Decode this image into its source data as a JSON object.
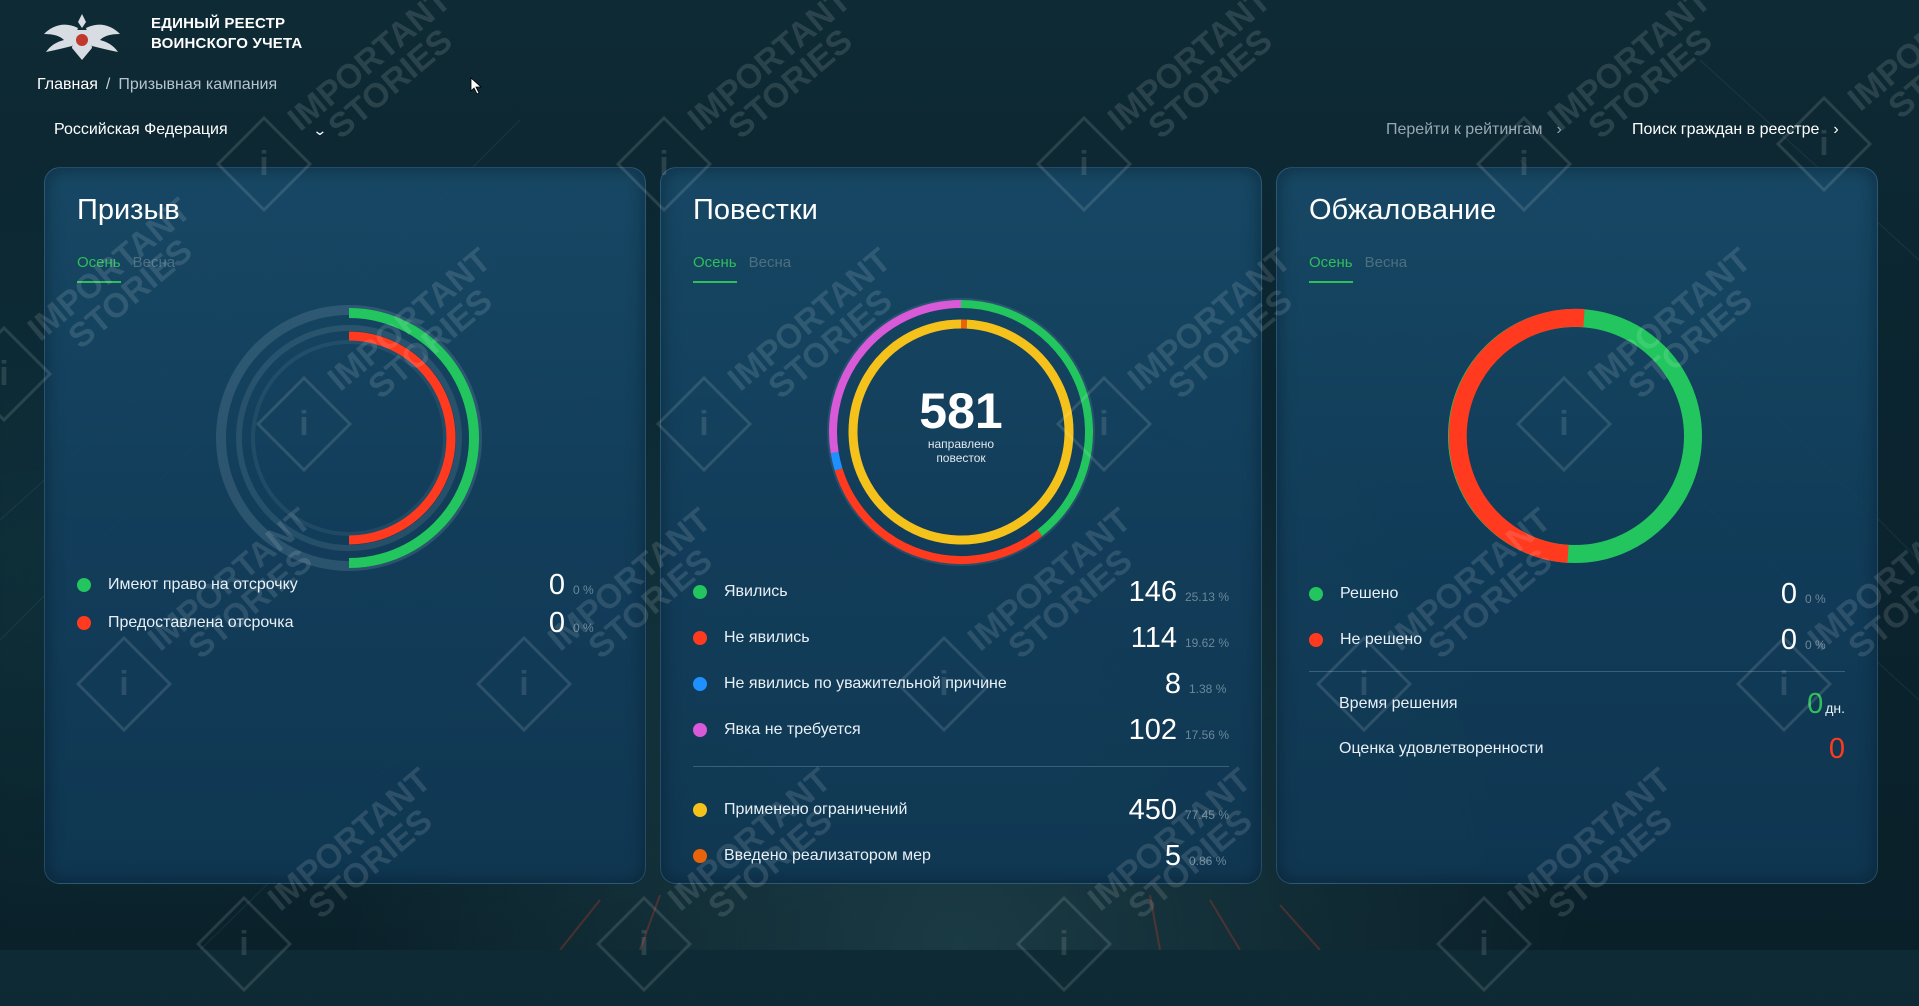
{
  "app": {
    "title_line1": "ЕДИНЫЙ РЕЕСТР",
    "title_line2": "ВОИНСКОГО УЧЕТА",
    "logo_icon": "double-headed-eagle-emblem-icon"
  },
  "breadcrumb": {
    "home": "Главная",
    "separator": "/",
    "current": "Призывная кампания"
  },
  "region_select": {
    "value": "Российская Федерация",
    "icon": "chevron-down-icon"
  },
  "header_links": {
    "ratings": "Перейти к рейтингам",
    "search": "Поиск граждан в реестре",
    "arrow": "›"
  },
  "colors": {
    "green": "#22c55e",
    "red": "#ff3a1f",
    "blue": "#1e90ff",
    "pink": "#d85ad8",
    "yellow": "#f5c21b",
    "orange": "#e8630a",
    "tab_active": "#2fbf5a"
  },
  "cards": {
    "conscription": {
      "title": "Призыв",
      "tabs": [
        "Осень",
        "Весна"
      ],
      "active_tab": "Осень",
      "legend": [
        {
          "label": "Имеют право на отсрочку",
          "value": "0",
          "pct": "0 %",
          "color": "green"
        },
        {
          "label": "Предоставлена отсрочка",
          "value": "0",
          "pct": "0 %",
          "color": "red"
        }
      ]
    },
    "summons": {
      "title": "Повестки",
      "tabs": [
        "Осень",
        "Весна"
      ],
      "active_tab": "Осень",
      "center_value": "581",
      "center_label_1": "направлено",
      "center_label_2": "повесток",
      "legend": [
        {
          "label": "Явились",
          "value": "146",
          "pct": "25.13 %",
          "color": "green"
        },
        {
          "label": "Не явились",
          "value": "114",
          "pct": "19.62 %",
          "color": "red"
        },
        {
          "label": "Не явились по уважительной причине",
          "value": "8",
          "pct": "1.38 %",
          "color": "blue"
        },
        {
          "label": "Явка не требуется",
          "value": "102",
          "pct": "17.56 %",
          "color": "pink"
        },
        {
          "label": "Применено ограничений",
          "value": "450",
          "pct": "77.45 %",
          "color": "yellow"
        },
        {
          "label": "Введено реализатором мер",
          "value": "5",
          "pct": "0.86 %",
          "color": "orange"
        }
      ]
    },
    "appeals": {
      "title": "Обжалование",
      "tabs": [
        "Осень",
        "Весна"
      ],
      "active_tab": "Осень",
      "legend": [
        {
          "label": "Решено",
          "value": "0",
          "pct": "0 %",
          "color": "green"
        },
        {
          "label": "Не решено",
          "value": "0",
          "pct": "0 %",
          "color": "red"
        }
      ],
      "stats": [
        {
          "label": "Время решения",
          "value": "0",
          "unit": "дн."
        },
        {
          "label": "Оценка удовлетворенности",
          "value": "0"
        }
      ]
    }
  },
  "watermark": {
    "line1": "IMPORTANT",
    "line2": "STORIES",
    "mark": "i"
  }
}
